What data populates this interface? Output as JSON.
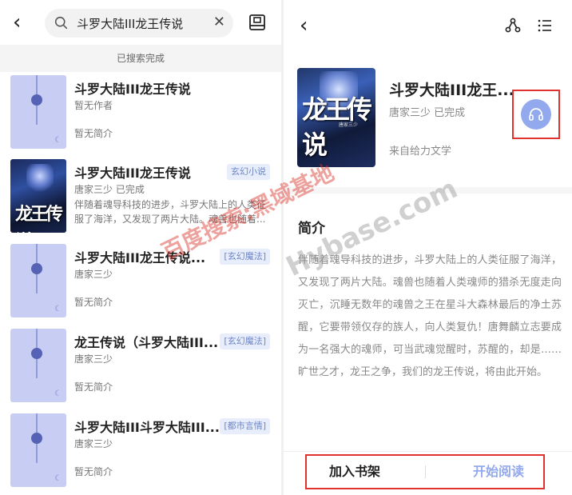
{
  "search": {
    "query": "斗罗大陆III龙王传说",
    "status": "已搜索完成"
  },
  "results": [
    {
      "title": "斗罗大陆III龙王传说",
      "author": "暂无作者",
      "intro": "暂无简介",
      "tag": ""
    },
    {
      "title": "斗罗大陆III龙王传说",
      "author": "唐家三少 已完成",
      "desc": "伴随着魂导科技的进步，斗罗大陆上的人类征服了海洋，又发现了两片大陆。魂兽也随着...",
      "tag": "玄幻小说"
    },
    {
      "title": "斗罗大陆III龙王传说...",
      "author": "唐家三少",
      "intro": "暂无简介",
      "tag": "[玄幻魔法]"
    },
    {
      "title": "龙王传说（斗罗大陆III...",
      "author": "唐家三少",
      "intro": "暂无简介",
      "tag": "[玄幻魔法]"
    },
    {
      "title": "斗罗大陆III斗罗大陆III...",
      "author": "唐家三少",
      "intro": "暂无简介",
      "tag": "[都市言情]"
    }
  ],
  "cover_art": {
    "logo": "龙王传说",
    "small_tag": "唐家三少"
  },
  "detail": {
    "title": "斗罗大陆III龙王...",
    "meta": "唐家三少 已完成",
    "source": "来自给力文学",
    "intro_heading": "简介",
    "intro": "伴随着魂导科技的进步，斗罗大陆上的人类征服了海洋，又发现了两片大陆。魂兽也随着人类魂师的猎杀无度走向灭亡，沉睡无数年的魂兽之王在星斗大森林最后的净土苏醒，它要带领仅存的族人，向人类复仇！唐舞麟立志要成为一名强大的魂师，可当武魂觉醒时，苏醒的，却是…… 旷世之才，龙王之争，我们的龙王传说，将由此开始。",
    "add_shelf": "加入书架",
    "start_read": "开始阅读"
  },
  "watermark": {
    "left": "百度搜索:黑域基地",
    "right": "Hybase.com"
  },
  "colors": {
    "accent": "#93a9ee",
    "highlight_border": "#e0332d",
    "tag_text": "#6d86c5"
  }
}
